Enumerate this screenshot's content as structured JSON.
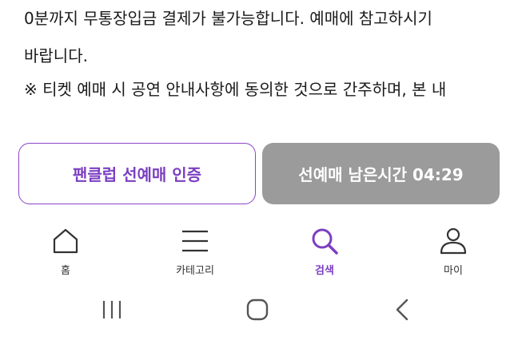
{
  "notice": {
    "line1": "0분까지 무통장입금 결제가 불가능합니다. 예매에 참고하시기",
    "line2": "바랍니다.",
    "line3": "※ 티켓 예매 시 공연 안내사항에 동의한 것으로 간주하며, 본 내"
  },
  "actions": {
    "auth_label": "팬클럽 선예매 인증",
    "timer_label": "선예매 남은시간 04:29"
  },
  "bottom_nav": {
    "items": [
      {
        "label": "홈",
        "icon": "home-icon"
      },
      {
        "label": "카테고리",
        "icon": "menu-icon"
      },
      {
        "label": "검색",
        "icon": "search-icon",
        "active": true
      },
      {
        "label": "마이",
        "icon": "user-icon"
      }
    ]
  },
  "colors": {
    "accent": "#7b3fc1",
    "timer_bg": "#9b9b9b"
  }
}
